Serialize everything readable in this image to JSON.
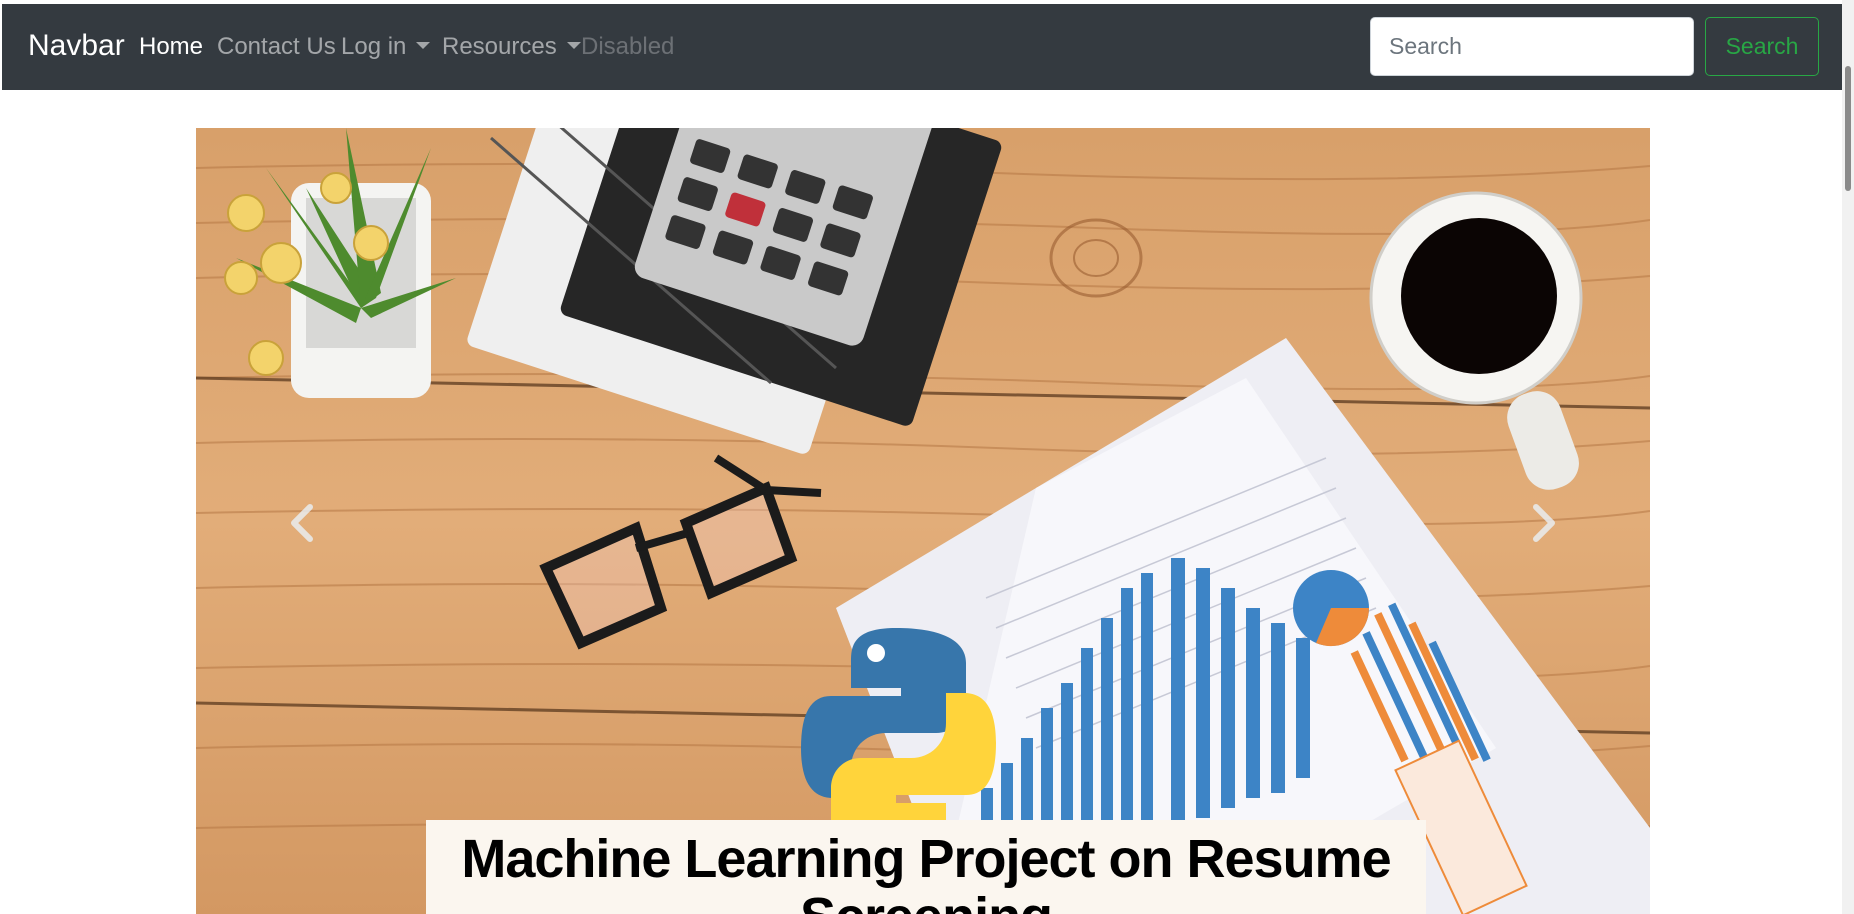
{
  "navbar": {
    "brand": "Navbar",
    "links": [
      {
        "label": "Home",
        "state": "active"
      },
      {
        "label": "Contact Us",
        "state": "normal"
      },
      {
        "label": "Log in",
        "state": "dropdown"
      },
      {
        "label": "Resources",
        "state": "dropdown"
      },
      {
        "label": "Disabled",
        "state": "disabled"
      }
    ],
    "search": {
      "placeholder": "Search",
      "value": "",
      "button_label": "Search"
    }
  },
  "carousel": {
    "slide": {
      "caption": "Machine Learning Project on Resume Screening",
      "image_subject": "desk with calculator, notebooks, glasses, coffee cup, plant, charts and Python logo"
    },
    "prev_icon": "chevron-left-icon",
    "next_icon": "chevron-right-icon"
  },
  "colors": {
    "navbar_bg": "#343a40",
    "accent_green": "#28a745",
    "wood": "#d9a06b",
    "python_blue": "#3776ab",
    "python_yellow": "#ffd43b"
  }
}
